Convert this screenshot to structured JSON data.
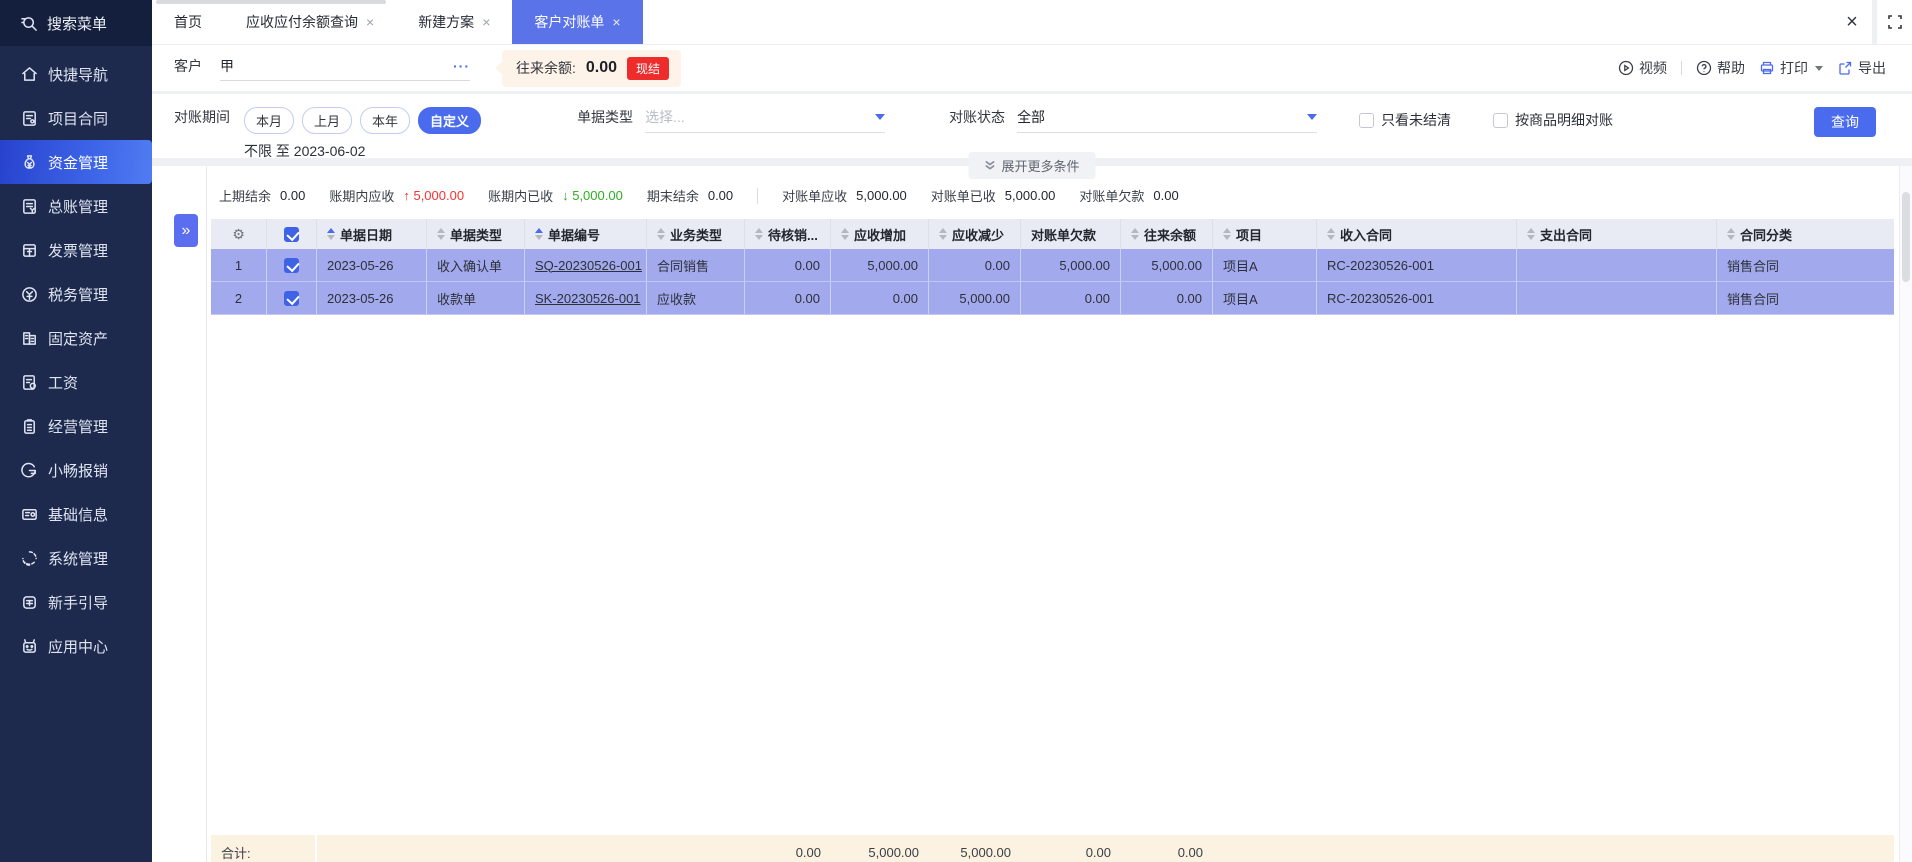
{
  "app_colors": {
    "accent": "#4a6bee",
    "sidebar": "#1d2a4e",
    "active_tab": "#5b73e8",
    "row": "#a3a9ed",
    "summary_up": "#f53333",
    "summary_down": "#2fae21",
    "badge_red": "#ee2c2c"
  },
  "sidebar": {
    "search_label": "搜索菜单",
    "items": [
      {
        "label": "快捷导航",
        "icon": "home-icon",
        "active": false
      },
      {
        "label": "项目合同",
        "icon": "project-contract-icon",
        "active": false
      },
      {
        "label": "资金管理",
        "icon": "funds-icon",
        "active": true
      },
      {
        "label": "总账管理",
        "icon": "general-ledger-icon",
        "active": false
      },
      {
        "label": "发票管理",
        "icon": "invoice-icon",
        "active": false
      },
      {
        "label": "税务管理",
        "icon": "tax-icon",
        "active": false
      },
      {
        "label": "固定资产",
        "icon": "fixed-assets-icon",
        "active": false
      },
      {
        "label": "工资",
        "icon": "salary-icon",
        "active": false
      },
      {
        "label": "经营管理",
        "icon": "operations-icon",
        "active": false
      },
      {
        "label": "小畅报销",
        "icon": "xiaochang-expense-icon",
        "active": false
      },
      {
        "label": "基础信息",
        "icon": "base-info-icon",
        "active": false
      },
      {
        "label": "系统管理",
        "icon": "system-icon",
        "active": false
      },
      {
        "label": "新手引导",
        "icon": "beginner-guide-icon",
        "active": false
      },
      {
        "label": "应用中心",
        "icon": "app-center-icon",
        "active": false
      }
    ]
  },
  "tabs": {
    "items": [
      {
        "label": "首页",
        "closable": false,
        "active": false
      },
      {
        "label": "应收应付余额查询",
        "closable": true,
        "active": false
      },
      {
        "label": "新建方案",
        "closable": true,
        "active": false
      },
      {
        "label": "客户对账单",
        "closable": true,
        "active": true
      }
    ]
  },
  "toolbar": {
    "customer_label": "客户",
    "customer_value": "甲",
    "balance_label": "往来余额:",
    "balance_value": "0.00",
    "balance_badge": "现结",
    "video": "视频",
    "help": "帮助",
    "print": "打印",
    "export": "导出"
  },
  "filters": {
    "period_label": "对账期间",
    "period_options": [
      "本月",
      "上月",
      "本年"
    ],
    "period_active": "自定义",
    "period_range": "不限 至 2023-06-02",
    "doc_type_label": "单据类型",
    "doc_type_placeholder": "选择...",
    "status_label": "对账状态",
    "status_value": "全部",
    "checkbox_unsettled": {
      "label": "只看未结清",
      "checked": false
    },
    "checkbox_by_item": {
      "label": "按商品明细对账",
      "checked": false
    },
    "query_button": "查询",
    "expand_more": "展开更多条件"
  },
  "summary": {
    "prev_balance": {
      "label": "上期结余",
      "value": "0.00"
    },
    "period_receivable": {
      "label": "账期内应收",
      "value": "5,000.00",
      "trend": "up"
    },
    "period_received": {
      "label": "账期内已收",
      "value": "5,000.00",
      "trend": "down"
    },
    "end_balance": {
      "label": "期末结余",
      "value": "0.00"
    },
    "stmt_receivable": {
      "label": "对账单应收",
      "value": "5,000.00"
    },
    "stmt_received": {
      "label": "对账单已收",
      "value": "5,000.00"
    },
    "stmt_debt": {
      "label": "对账单欠款",
      "value": "0.00"
    }
  },
  "table": {
    "columns": [
      {
        "label": "单据日期",
        "sort": "asc"
      },
      {
        "label": "单据类型",
        "sort": "both"
      },
      {
        "label": "单据编号",
        "sort": "asc"
      },
      {
        "label": "业务类型",
        "sort": "both"
      },
      {
        "label": "待核销...",
        "sort": "both"
      },
      {
        "label": "应收增加",
        "sort": "both"
      },
      {
        "label": "应收减少",
        "sort": "both"
      },
      {
        "label": "对账单欠款",
        "sort": "none"
      },
      {
        "label": "往来余额",
        "sort": "both"
      },
      {
        "label": "项目",
        "sort": "both"
      },
      {
        "label": "收入合同",
        "sort": "both"
      },
      {
        "label": "支出合同",
        "sort": "both"
      },
      {
        "label": "合同分类",
        "sort": "both"
      }
    ],
    "rows": [
      {
        "num": "1",
        "checked": true,
        "date": "2023-05-26",
        "doc_type": "收入确认单",
        "doc_no": "SQ-20230526-001",
        "biz_type": "合同销售",
        "pending": "0.00",
        "receivable_inc": "5,000.00",
        "receivable_dec": "0.00",
        "statement_debt": "5,000.00",
        "balance": "5,000.00",
        "project": "项目A",
        "income_contract": "RC-20230526-001",
        "expense_contract": "",
        "contract_category": "销售合同"
      },
      {
        "num": "2",
        "checked": true,
        "date": "2023-05-26",
        "doc_type": "收款单",
        "doc_no": "SK-20230526-001",
        "biz_type": "应收款",
        "pending": "0.00",
        "receivable_inc": "0.00",
        "receivable_dec": "5,000.00",
        "statement_debt": "0.00",
        "balance": "0.00",
        "project": "项目A",
        "income_contract": "RC-20230526-001",
        "expense_contract": "",
        "contract_category": "销售合同"
      }
    ],
    "footer": {
      "label": "合计:",
      "pending": "0.00",
      "receivable_inc": "5,000.00",
      "receivable_dec": "5,000.00",
      "statement_debt": "0.00",
      "balance": "0.00"
    }
  }
}
